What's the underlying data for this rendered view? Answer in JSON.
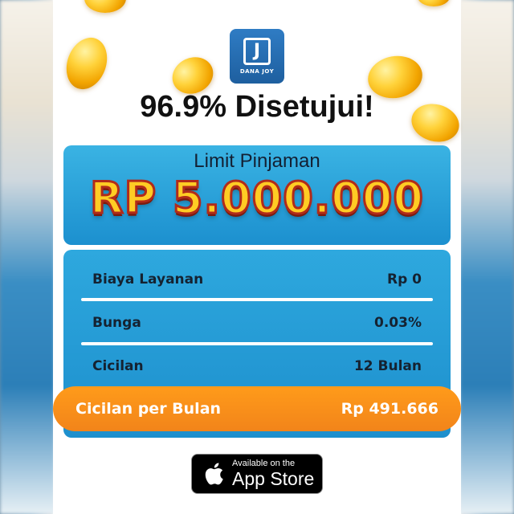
{
  "logo": {
    "mark": "J",
    "brand": "DANA JOY"
  },
  "headline": "96.9% Disetujui!",
  "limit": {
    "title": "Limit Pinjaman",
    "amount": "RP 5.000.000"
  },
  "details": [
    {
      "label": "Biaya Layanan",
      "value": "Rp 0"
    },
    {
      "label": "Bunga",
      "value": "0.03%"
    },
    {
      "label": "Cicilan",
      "value": "12 Bulan"
    }
  ],
  "monthly": {
    "label": "Cicilan per Bulan",
    "value": "Rp 491.666"
  },
  "appstore": {
    "small": "Available on the",
    "big": "App Store"
  },
  "colors": {
    "accent_blue": "#1d8fcd",
    "accent_orange": "#f2841a",
    "amount_gold": "#ffcc24",
    "amount_outline": "#b12b1a",
    "logo_blue": "#2f7cc4"
  },
  "icons": [
    "apple-icon",
    "coin-icon"
  ]
}
